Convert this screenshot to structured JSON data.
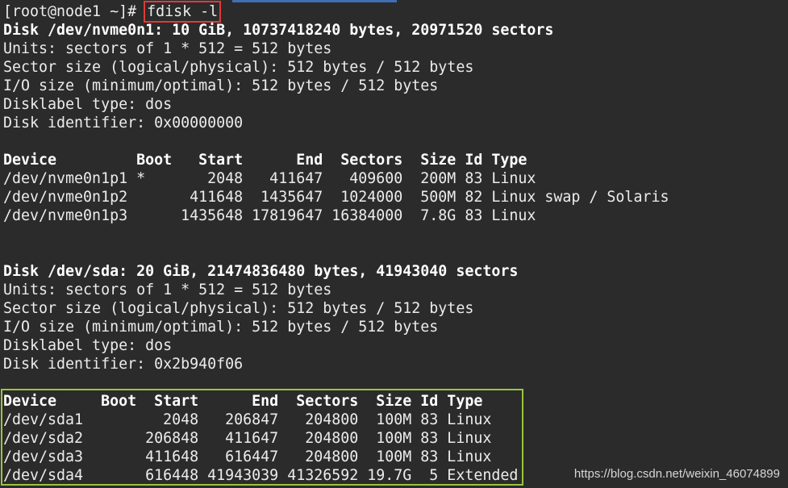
{
  "terminal": {
    "prompt": "[root@node1 ~]# ",
    "command": "fdisk -l",
    "lines": [
      {
        "text": "Disk /dev/nvme0n1: 10 GiB, 10737418240 bytes, 20971520 sectors",
        "style": "bold"
      },
      {
        "text": "Units: sectors of 1 * 512 = 512 bytes",
        "style": "normal"
      },
      {
        "text": "Sector size (logical/physical): 512 bytes / 512 bytes",
        "style": "normal"
      },
      {
        "text": "I/O size (minimum/optimal): 512 bytes / 512 bytes",
        "style": "normal"
      },
      {
        "text": "Disklabel type: dos",
        "style": "normal"
      },
      {
        "text": "Disk identifier: 0x00000000",
        "style": "normal"
      },
      {
        "text": "",
        "style": "normal"
      },
      {
        "text": "Device         Boot   Start      End  Sectors  Size Id Type",
        "style": "hdr"
      },
      {
        "text": "/dev/nvme0n1p1 *       2048   411647   409600  200M 83 Linux",
        "style": "normal"
      },
      {
        "text": "/dev/nvme0n1p2       411648  1435647  1024000  500M 82 Linux swap / Solaris",
        "style": "normal"
      },
      {
        "text": "/dev/nvme0n1p3      1435648 17819647 16384000  7.8G 83 Linux",
        "style": "normal"
      },
      {
        "text": "",
        "style": "normal"
      },
      {
        "text": "",
        "style": "normal"
      },
      {
        "text": "Disk /dev/sda: 20 GiB, 21474836480 bytes, 41943040 sectors",
        "style": "bold"
      },
      {
        "text": "Units: sectors of 1 * 512 = 512 bytes",
        "style": "normal"
      },
      {
        "text": "Sector size (logical/physical): 512 bytes / 512 bytes",
        "style": "normal"
      },
      {
        "text": "I/O size (minimum/optimal): 512 bytes / 512 bytes",
        "style": "normal"
      },
      {
        "text": "Disklabel type: dos",
        "style": "normal"
      },
      {
        "text": "Disk identifier: 0x2b940f06",
        "style": "normal"
      },
      {
        "text": "",
        "style": "normal"
      },
      {
        "text": "Device     Boot  Start      End  Sectors  Size Id Type",
        "style": "hdr"
      },
      {
        "text": "/dev/sda1         2048   206847   204800  100M 83 Linux",
        "style": "normal"
      },
      {
        "text": "/dev/sda2       206848   411647   204800  100M 83 Linux",
        "style": "normal"
      },
      {
        "text": "/dev/sda3       411648   616447   204800  100M 83 Linux",
        "style": "normal"
      },
      {
        "text": "/dev/sda4       616448 41943039 41326592 19.7G  5 Extended",
        "style": "normal"
      }
    ]
  },
  "watermark": "https://blog.csdn.net/weixin_46074899",
  "colors": {
    "background": "#2b2b2b",
    "text": "#ececec",
    "command_highlight": "#e0393b",
    "table_highlight": "#9bc43c"
  }
}
